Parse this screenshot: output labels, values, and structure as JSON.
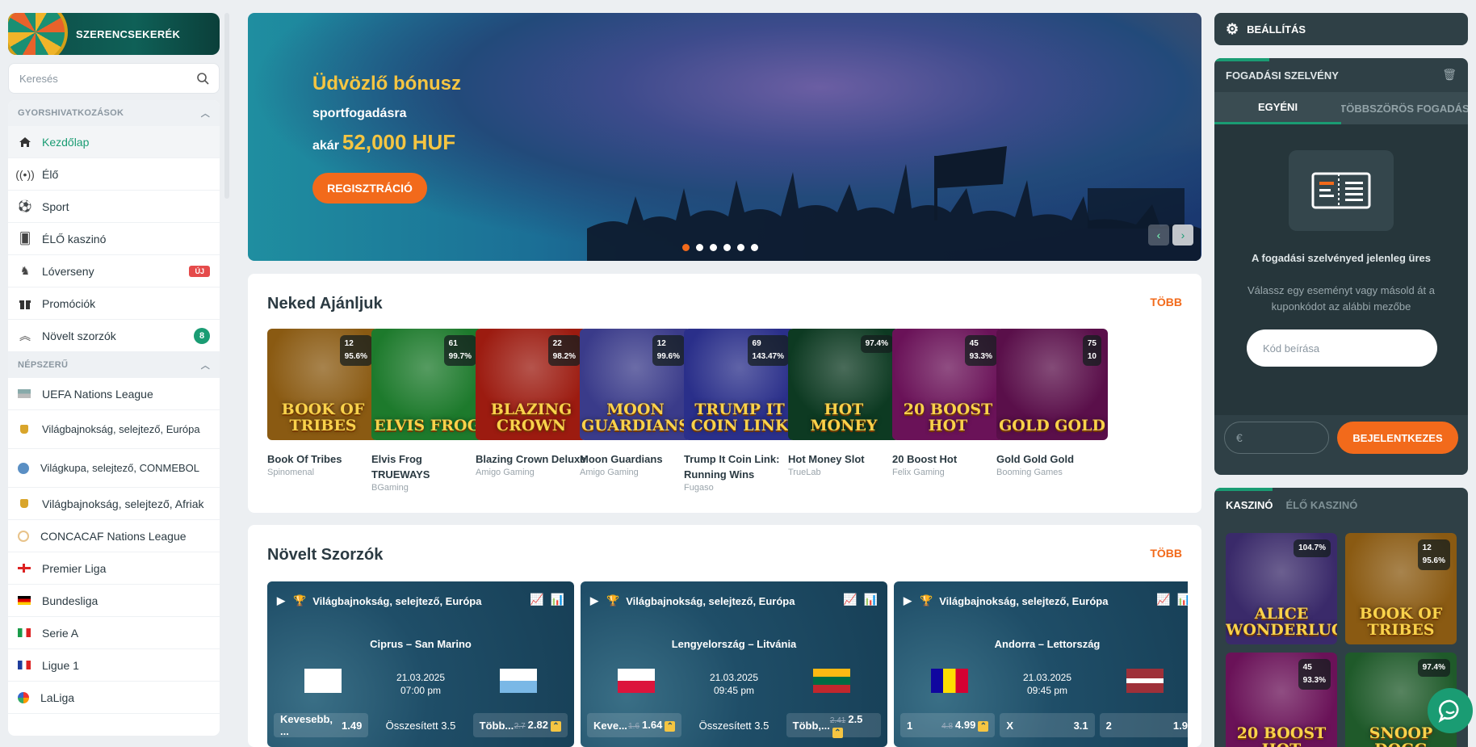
{
  "sidebar": {
    "wheel_title": "SZERENCSEKERÉK",
    "search_placeholder": "Keresés",
    "quick_header": "GYORSHIVATKOZÁSOK",
    "quick_items": [
      {
        "label": "Kezdőlap",
        "icon": "home-icon"
      },
      {
        "label": "Élő",
        "icon": "live-icon"
      },
      {
        "label": "Sport",
        "icon": "soccer-ball-icon"
      },
      {
        "label": "ÉLŐ kaszinó",
        "icon": "cards-icon"
      },
      {
        "label": "Lóverseny",
        "icon": "horse-icon",
        "badge": "ÚJ"
      },
      {
        "label": "Promóciók",
        "icon": "gift-icon"
      },
      {
        "label": "Növelt szorzók",
        "icon": "boost-icon",
        "count": "8"
      }
    ],
    "popular_header": "NÉPSZERŰ",
    "popular_items": [
      {
        "label": "UEFA Nations League"
      },
      {
        "label": "Világbajnokság, selejtező, Európa"
      },
      {
        "label": "Világkupa, selejtező, CONMEBOL"
      },
      {
        "label": "Világbajnokság, selejtező, Afriak"
      },
      {
        "label": "CONCACAF Nations League"
      },
      {
        "label": "Premier Liga"
      },
      {
        "label": "Bundesliga"
      },
      {
        "label": "Serie A"
      },
      {
        "label": "Ligue 1"
      },
      {
        "label": "LaLiga"
      }
    ]
  },
  "hero": {
    "line1": "Üdvözlő bónusz",
    "line2": "sportfogadásra",
    "line3_prefix": "akár",
    "line3_amount": "52,000 HUF",
    "button": "REGISZTRÁCIÓ"
  },
  "recommended": {
    "title": "Neked Ajánljuk",
    "more": "TÖBB",
    "games": [
      {
        "name": "Book Of Tribes",
        "provider": "Spinomenal",
        "logo": "BOOK OF TRIBES",
        "stat1": "12",
        "stat2": "95.6%",
        "bg": "#8a5a12"
      },
      {
        "name": "Elvis Frog TRUEWAYS",
        "provider": "BGaming",
        "logo": "ELVIS FROG",
        "stat1": "61",
        "stat2": "99.7%",
        "bg": "#1d7a2c"
      },
      {
        "name": "Blazing Crown Deluxe",
        "provider": "Amigo Gaming",
        "logo": "BLAZING CROWN",
        "stat1": "22",
        "stat2": "98.2%",
        "bg": "#9c1b10"
      },
      {
        "name": "Moon Guardians",
        "provider": "Amigo Gaming",
        "logo": "MOON GUARDIANS",
        "stat1": "12",
        "stat2": "99.6%",
        "bg": "#3a3b8a"
      },
      {
        "name": "Trump It Coin Link: Running Wins",
        "provider": "Fugaso",
        "logo": "TRUMP IT COIN LINK",
        "stat1": "69",
        "stat2": "143.47%",
        "bg": "#2a2f8a"
      },
      {
        "name": "Hot Money Slot",
        "provider": "TrueLab",
        "logo": "HOT MONEY",
        "stat1": "",
        "stat2": "97.4%",
        "bg": "#0d3a22"
      },
      {
        "name": "20 Boost Hot",
        "provider": "Felix Gaming",
        "logo": "20 BOOST HOT",
        "stat1": "45",
        "stat2": "93.3%",
        "bg": "#6a1258"
      },
      {
        "name": "Gold Gold Gold",
        "provider": "Booming Games",
        "logo": "GOLD GOLD",
        "stat1": "75",
        "stat2": "10",
        "bg": "#5a0f4a"
      }
    ]
  },
  "boosted": {
    "title": "Növelt Szorzók",
    "more": "TÖBB",
    "matches": [
      {
        "league": "Világbajnokság, selejtező, Európa",
        "teams": "Ciprus – San Marino",
        "date": "21.03.2025",
        "time": "07:00 pm",
        "odds": [
          {
            "label": "Kevesebb, ...",
            "old": "",
            "val": "1.49"
          },
          {
            "label": "Összesített 3.5",
            "old": "",
            "val": ""
          },
          {
            "label": "Több...",
            "old": "2.7",
            "val": "2.82"
          }
        ]
      },
      {
        "league": "Világbajnokság, selejtező, Európa",
        "teams": "Lengyelország – Litvánia",
        "date": "21.03.2025",
        "time": "09:45 pm",
        "odds": [
          {
            "label": "Keve...",
            "old": "1.6",
            "val": "1.64"
          },
          {
            "label": "Összesített 3.5",
            "old": "",
            "val": ""
          },
          {
            "label": "Több,...",
            "old": "2.41",
            "val": "2.5"
          }
        ]
      },
      {
        "league": "Világbajnokság, selejtező, Európa",
        "teams": "Andorra – Lettország",
        "date": "21.03.2025",
        "time": "09:45 pm",
        "odds": [
          {
            "label": "1",
            "old": "4.8",
            "val": "4.99"
          },
          {
            "label": "X",
            "old": "",
            "val": "3.1"
          },
          {
            "label": "2",
            "old": "",
            "val": "1.9"
          }
        ]
      }
    ]
  },
  "settings": {
    "label": "BEÁLLÍTÁS"
  },
  "betslip": {
    "title": "FOGADÁSI SZELVÉNY",
    "tab_single": "EGYÉNI",
    "tab_multi": "TÖBBSZÖRÖS FOGADÁS",
    "empty": "A fogadási szelvényed jelenleg üres",
    "hint": "Válassz egy eseményt vagy másold át a kuponkódot az alábbi mezőbe",
    "code_placeholder": "Kód beírása",
    "stake_currency": "€",
    "login": "BEJELENTKEZES"
  },
  "casino": {
    "tab_casino": "KASZINÓ",
    "tab_live": "ÉLŐ KASZINÓ",
    "games": [
      {
        "logo": "ALICE WONDERLUCK",
        "stat1": "",
        "stat2": "104.7%",
        "bg": "#3a2a6a"
      },
      {
        "logo": "BOOK OF TRIBES",
        "stat1": "12",
        "stat2": "95.6%",
        "bg": "#8a5a12"
      },
      {
        "logo": "20 BOOST HOT",
        "stat1": "45",
        "stat2": "93.3%",
        "bg": "#6a1258"
      },
      {
        "logo": "SNOOP DOGG",
        "stat1": "",
        "stat2": "97.4%",
        "bg": "#1f5a2a"
      }
    ]
  },
  "colors": {
    "accent": "#1a9c73",
    "orange": "#f26a1b",
    "dark_panel": "#2f4046"
  }
}
